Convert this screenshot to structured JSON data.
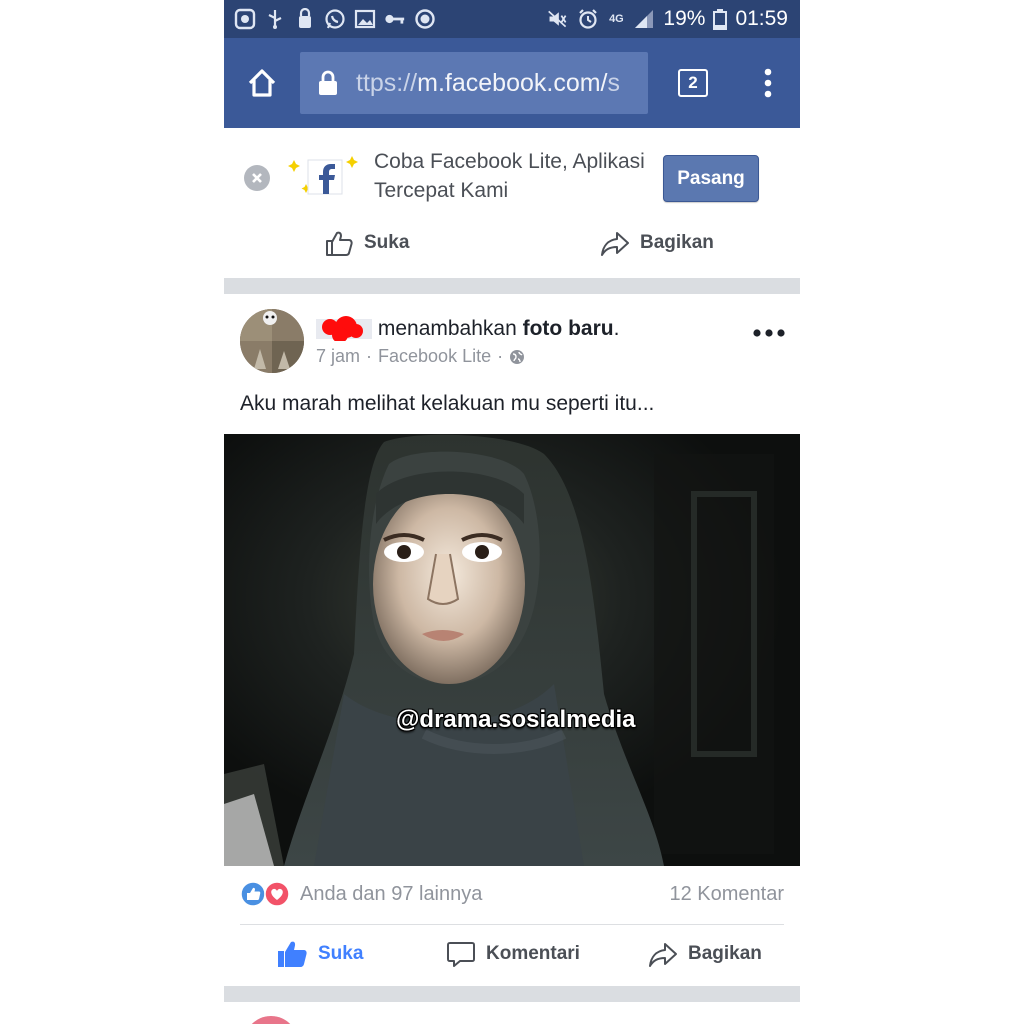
{
  "status_bar": {
    "battery_percent": "19%",
    "time": "01:59",
    "network": "4G",
    "left_icons": [
      "screenshot-icon",
      "usb-icon",
      "bluetooth-lock-icon",
      "whatsapp-icon",
      "gallery-icon",
      "key-icon",
      "record-icon"
    ],
    "right_icons": [
      "mute-icon",
      "alarm-icon",
      "signal-icon",
      "battery-icon"
    ]
  },
  "browser": {
    "url_prefix": "ttps://",
    "url_host": "m.facebook.com/",
    "url_tail": "s",
    "tab_count": "2",
    "icons": [
      "home-icon",
      "lock-icon",
      "tabs-icon",
      "menu-icon"
    ]
  },
  "promo": {
    "text": "Coba Facebook Lite, Aplikasi Tercepat Kami",
    "install_label": "Pasang",
    "like_label": "Suka",
    "share_label": "Bagikan"
  },
  "post": {
    "action_text": "menambahkan",
    "action_bold": "foto baru",
    "action_end": ".",
    "time": "7 jam",
    "source": "Facebook Lite",
    "meta_sep": "·",
    "text": "Aku marah melihat kelakuan mu seperti itu...",
    "watermark": "@drama.sosialmedia",
    "reactions_text": "Anda dan 97 lainnya",
    "comments_text": "12 Komentar",
    "like_label": "Suka",
    "comment_label": "Komentari",
    "share_label": "Bagikan"
  },
  "colors": {
    "status_bar": "#2c4474",
    "browser_bar": "#3b5998",
    "url_box": "#5c78b3",
    "install_button": "#5b78b0",
    "liked_blue": "#4080ff",
    "love_red": "#f25268"
  }
}
